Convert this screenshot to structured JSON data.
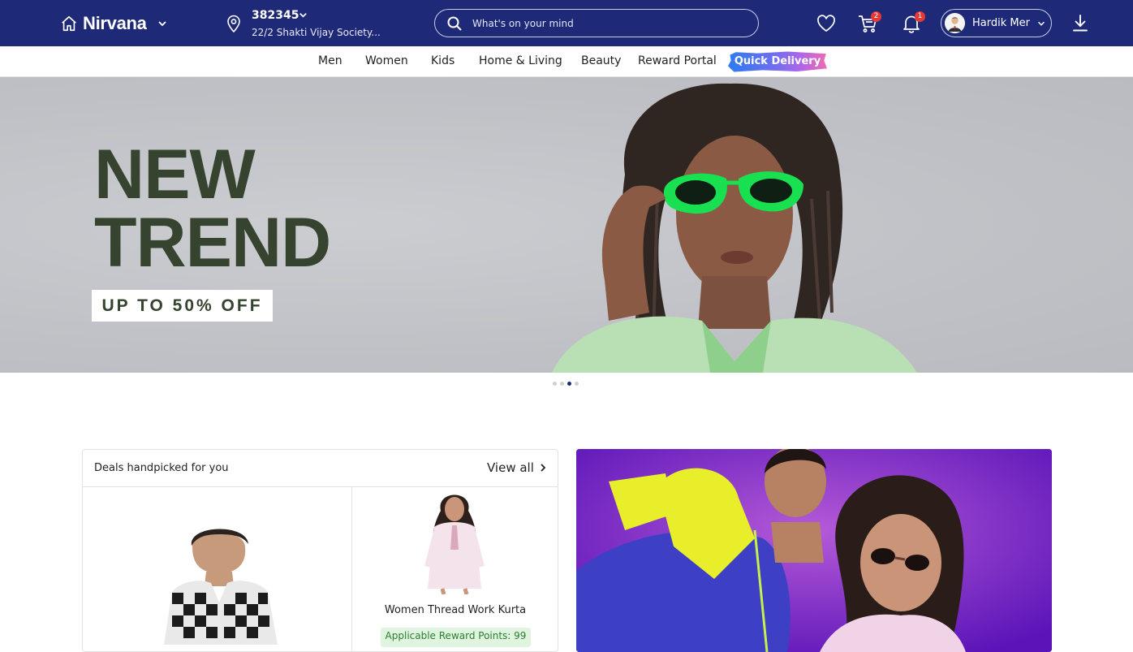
{
  "header": {
    "brand": "Nirvana",
    "location": {
      "pincode": "382345",
      "address": "22/2 Shakti Vijay Society..."
    },
    "search": {
      "placeholder": "What's on your mind"
    },
    "cart_count": "2",
    "notification_count": "1",
    "user_name": "Hardik Mer"
  },
  "nav": {
    "items": [
      "Men",
      "Women",
      "Kids",
      "Home & Living",
      "Beauty",
      "Reward Portal"
    ],
    "quick_delivery": "Quick Delivery"
  },
  "hero": {
    "title_line1": "NEW",
    "title_line2": "TREND",
    "offer": "UP TO 50% OFF",
    "active_slide": 3,
    "slide_count": 4
  },
  "deals": {
    "title": "Deals handpicked for you",
    "view_all": "View all",
    "products": [
      {
        "name": ""
      },
      {
        "name": "Women Thread Work Kurta",
        "reward": "Applicable Reward Points: 99"
      }
    ]
  },
  "colors": {
    "header_bg": "#1e2a78",
    "hero_bg": "#c3c5c9",
    "hero_text": "#35432f",
    "promo_bg": "#6a1fc7",
    "reward_bg": "#dff5df",
    "reward_text": "#2e7d32"
  },
  "icons": [
    "home-icon",
    "chevron-down-icon",
    "location-pin-icon",
    "search-icon",
    "heart-icon",
    "cart-icon",
    "bell-icon",
    "avatar",
    "download-icon",
    "chevron-right-icon"
  ]
}
